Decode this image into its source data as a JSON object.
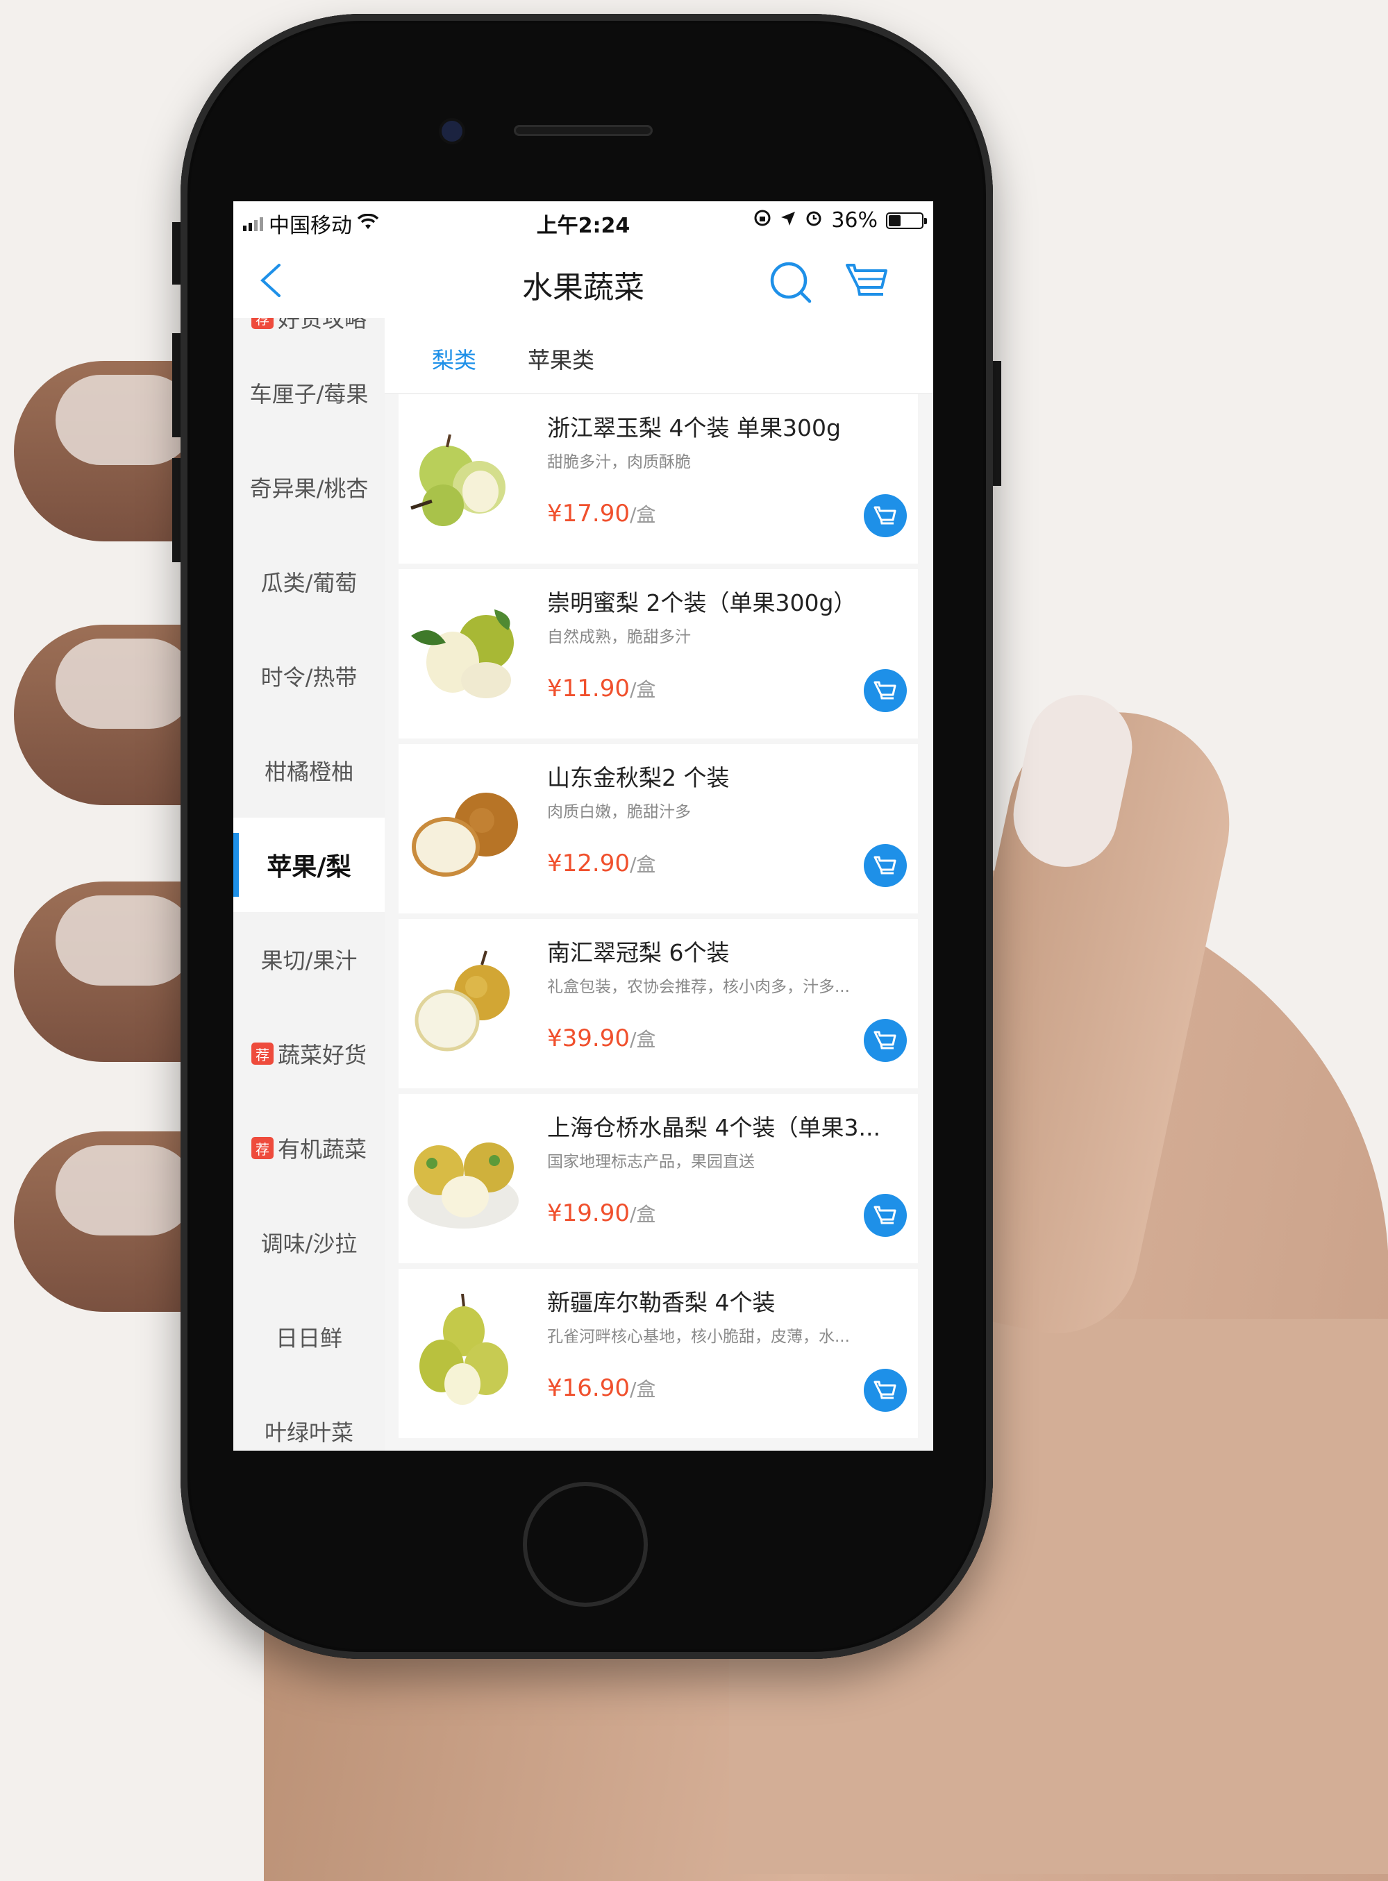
{
  "status_bar": {
    "carrier": "中国移动",
    "time": "上午2:24",
    "battery": "36%",
    "battery_level": 0.36
  },
  "nav": {
    "title": "水果蔬菜",
    "back_icon": "chevron-left-icon",
    "search_icon": "search-icon",
    "cart_icon": "cart-icon"
  },
  "sidebar": {
    "items": [
      {
        "label": "好货攻略",
        "badge": "荐"
      },
      {
        "label": "车厘子/莓果"
      },
      {
        "label": "奇异果/桃杏"
      },
      {
        "label": "瓜类/葡萄"
      },
      {
        "label": "时令/热带"
      },
      {
        "label": "柑橘橙柚"
      },
      {
        "label": "苹果/梨",
        "active": true
      },
      {
        "label": "果切/果汁"
      },
      {
        "label": "蔬菜好货",
        "badge": "荐"
      },
      {
        "label": "有机蔬菜",
        "badge": "荐"
      },
      {
        "label": "调味/沙拉"
      },
      {
        "label": "日日鲜"
      },
      {
        "label": "叶绿叶菜"
      }
    ]
  },
  "tabs": [
    {
      "label": "梨类",
      "active": true
    },
    {
      "label": "苹果类"
    }
  ],
  "products": [
    {
      "name": "浙江翠玉梨 4个装 单果300g",
      "desc": "甜脆多汁，肉质酥脆",
      "price": "¥17.90",
      "unit": "/盒"
    },
    {
      "name": "崇明蜜梨 2个装（单果300g）",
      "desc": "自然成熟，脆甜多汁",
      "price": "¥11.90",
      "unit": "/盒"
    },
    {
      "name": "山东金秋梨2 个装",
      "desc": "肉质白嫩，脆甜汁多",
      "price": "¥12.90",
      "unit": "/盒"
    },
    {
      "name": "南汇翠冠梨 6个装",
      "desc": "礼盒包装，农协会推荐，核小肉多，汁多...",
      "price": "¥39.90",
      "unit": "/盒"
    },
    {
      "name": "上海仓桥水晶梨 4个装（单果3...",
      "desc": "国家地理标志产品，果园直送",
      "price": "¥19.90",
      "unit": "/盒"
    },
    {
      "name": "新疆库尔勒香梨 4个装",
      "desc": "孔雀河畔核心基地，核小脆甜，皮薄，水...",
      "price": "¥16.90",
      "unit": "/盒"
    }
  ],
  "colors": {
    "accent": "#1e90e8",
    "price": "#f0502d",
    "badge": "#ee4b3c"
  }
}
